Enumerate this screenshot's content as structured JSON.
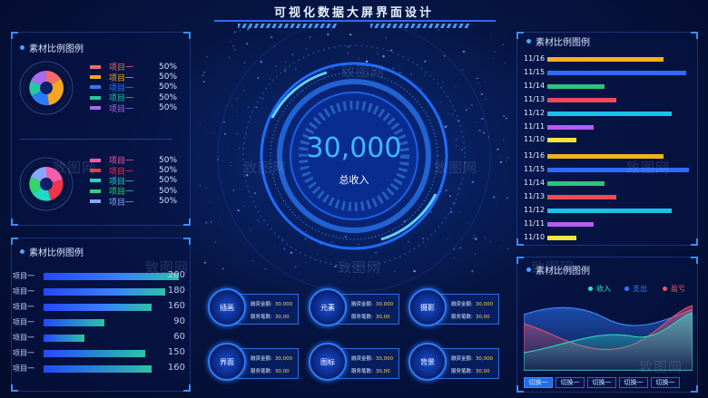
{
  "header": {
    "title": "可视化数据大屏界面设计"
  },
  "donut_panel": {
    "title": "素材比例图例",
    "legend_top": [
      {
        "label": "项目一",
        "value": "50%",
        "color": "#f26a6a"
      },
      {
        "label": "项目一",
        "value": "50%",
        "color": "#f5a623"
      },
      {
        "label": "项目一",
        "value": "50%",
        "color": "#2f7bff"
      },
      {
        "label": "项目一",
        "value": "50%",
        "color": "#27c9a0"
      },
      {
        "label": "项目一",
        "value": "50%",
        "color": "#a76cf0"
      }
    ],
    "legend_bottom": [
      {
        "label": "项目一",
        "value": "50%",
        "color": "#f05fa8"
      },
      {
        "label": "项目一",
        "value": "50%",
        "color": "#f0344a"
      },
      {
        "label": "项目一",
        "value": "50%",
        "color": "#22d6c8"
      },
      {
        "label": "项目一",
        "value": "50%",
        "color": "#33d66b"
      },
      {
        "label": "项目一",
        "value": "50%",
        "color": "#8aa7ff"
      }
    ]
  },
  "bar_panel": {
    "title": "素材比例图例",
    "rows": [
      {
        "label": "项目一",
        "value": 200
      },
      {
        "label": "项目一",
        "value": 180
      },
      {
        "label": "项目一",
        "value": 160
      },
      {
        "label": "项目一",
        "value": 90
      },
      {
        "label": "项目一",
        "value": 60
      },
      {
        "label": "项目一",
        "value": 150
      },
      {
        "label": "项目一",
        "value": 160
      }
    ]
  },
  "center": {
    "total": "30,000",
    "total_label": "总收入"
  },
  "cards": [
    {
      "name": "插画",
      "l1": "融资金额:",
      "v1": "30,000",
      "l2": "服务笔数:",
      "v2": "30,00"
    },
    {
      "name": "元素",
      "l1": "融资金额:",
      "v1": "30,000",
      "l2": "服务笔数:",
      "v2": "30,00"
    },
    {
      "name": "摄影",
      "l1": "融资金额:",
      "v1": "30,000",
      "l2": "服务笔数:",
      "v2": "30,00"
    },
    {
      "name": "界面",
      "l1": "融资金额:",
      "v1": "30,000",
      "l2": "服务笔数:",
      "v2": "30,00"
    },
    {
      "name": "图标",
      "l1": "融资金额:",
      "v1": "30,000",
      "l2": "服务笔数:",
      "v2": "30,00"
    },
    {
      "name": "背景",
      "l1": "融资金额:",
      "v1": "30,000",
      "l2": "服务笔数:",
      "v2": "30,00"
    }
  ],
  "right_bars": {
    "title": "素材比例图例",
    "rows": [
      {
        "date": "11/16",
        "value": 0.81,
        "color": "#f5b21f"
      },
      {
        "date": "11/15",
        "value": 0.97,
        "color": "#2f6bff"
      },
      {
        "date": "11/14",
        "value": 0.4,
        "color": "#2ec27e"
      },
      {
        "date": "11/13",
        "value": 0.48,
        "color": "#f04a5a"
      },
      {
        "date": "11/12",
        "value": 0.87,
        "color": "#19c2e6"
      },
      {
        "date": "11/11",
        "value": 0.32,
        "color": "#b45cf0"
      },
      {
        "date": "11/10",
        "value": 0.2,
        "color": "#f7e43a"
      },
      {
        "date": "11/16",
        "value": 0.81,
        "color": "#f5b21f"
      },
      {
        "date": "11/15",
        "value": 0.99,
        "color": "#2f6bff"
      },
      {
        "date": "11/14",
        "value": 0.4,
        "color": "#2ec27e"
      },
      {
        "date": "11/13",
        "value": 0.48,
        "color": "#f04a5a"
      },
      {
        "date": "11/12",
        "value": 0.87,
        "color": "#19c2e6"
      },
      {
        "date": "11/11",
        "value": 0.32,
        "color": "#b45cf0"
      },
      {
        "date": "11/10",
        "value": 0.2,
        "color": "#f7e43a"
      }
    ]
  },
  "area_panel": {
    "title": "素材比例图例",
    "legend": [
      {
        "label": "收入",
        "color": "#2fe0c0"
      },
      {
        "label": "支出",
        "color": "#2f7bff"
      },
      {
        "label": "盈亏",
        "color": "#f0506a"
      }
    ],
    "tabs": [
      "切换一",
      "切换一",
      "切换一",
      "切换一",
      "切换一"
    ]
  },
  "watermark": "致图网"
}
